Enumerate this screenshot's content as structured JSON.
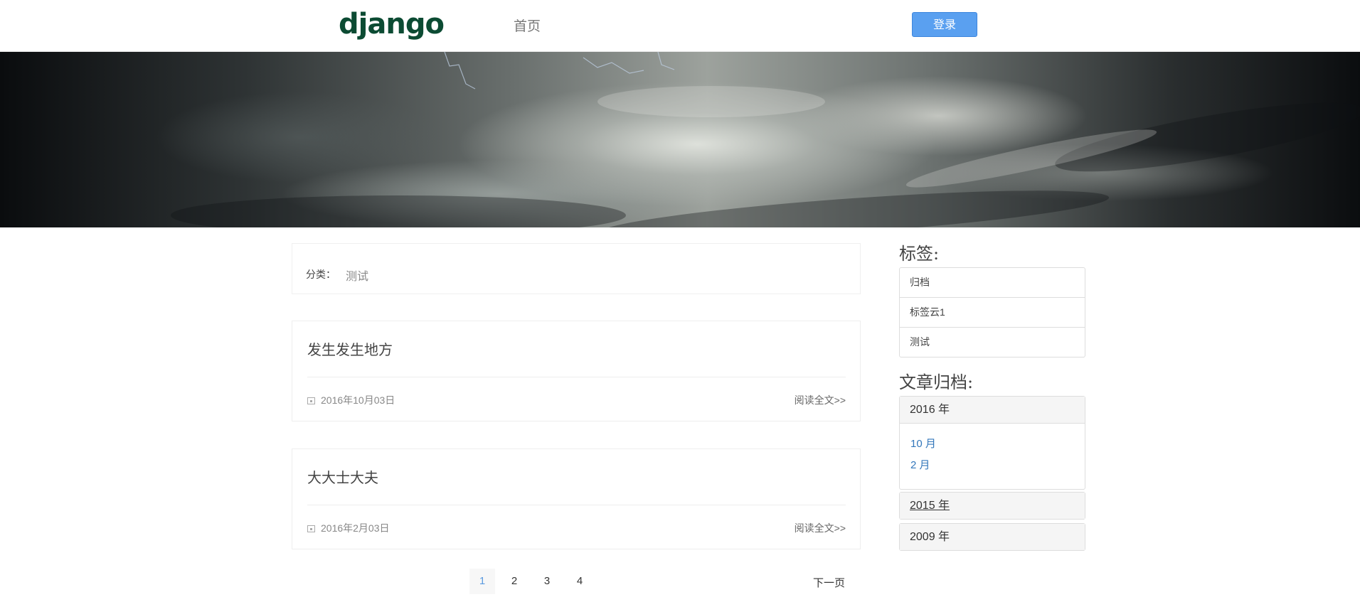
{
  "header": {
    "logo": "django",
    "nav_home": "首页",
    "login": "登录"
  },
  "category": {
    "label": "分类：",
    "value": "测试"
  },
  "posts": [
    {
      "title": "发生发生地方",
      "date": "2016年10月03日",
      "read_more": "阅读全文>>"
    },
    {
      "title": "大大士大夫",
      "date": "2016年2月03日",
      "read_more": "阅读全文>>"
    }
  ],
  "pagination": {
    "pages": [
      "1",
      "2",
      "3",
      "4"
    ],
    "active": "1",
    "next": "下一页"
  },
  "sidebar": {
    "tags_title": "标签:",
    "tags": [
      "归档",
      "标签云1",
      "测试"
    ],
    "archive_title": "文章归档:",
    "years": [
      {
        "label": "2016 年",
        "months": [
          "10 月",
          "2 月"
        ]
      },
      {
        "label": "2015 年"
      },
      {
        "label": "2009 年"
      }
    ]
  },
  "colors": {
    "logo": "#0c4b33",
    "login_button": "#5aa0f0",
    "link": "#3377bb",
    "active_page": "#5b9be0"
  }
}
